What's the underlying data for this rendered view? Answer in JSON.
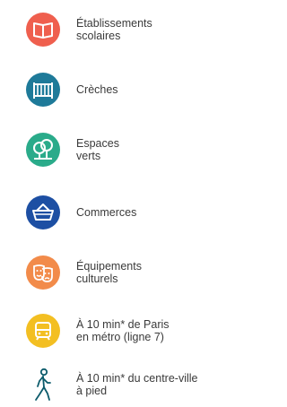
{
  "colors": {
    "schools": "#ef5f4e",
    "nursery": "#1e7a99",
    "green": "#2aab8a",
    "shops": "#1d4fa3",
    "culture": "#f28b4a",
    "transport": "#f3bf22",
    "walk": "#0c5b6b"
  },
  "items": [
    {
      "label": "Établissements\nscolaires",
      "icon": "open-book-icon"
    },
    {
      "label": "Crèches",
      "icon": "crib-icon"
    },
    {
      "label": "Espaces\nverts",
      "icon": "trees-icon"
    },
    {
      "label": "Commerces",
      "icon": "shopping-basket-icon"
    },
    {
      "label": "Équipements\nculturels",
      "icon": "theater-masks-icon"
    },
    {
      "label": "À 10 min* de Paris\nen métro (ligne 7)",
      "icon": "metro-train-icon"
    },
    {
      "label": "À 10 min* du centre-ville\nà pied",
      "icon": "walking-person-icon"
    }
  ]
}
